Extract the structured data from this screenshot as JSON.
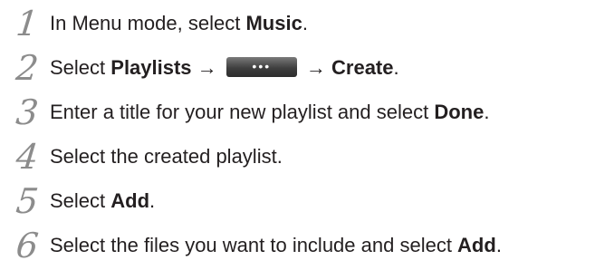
{
  "steps": [
    {
      "number": "1",
      "parts": [
        {
          "text": "In Menu mode, select ",
          "bold": false
        },
        {
          "text": "Music",
          "bold": true
        },
        {
          "text": ".",
          "bold": false
        }
      ]
    },
    {
      "number": "2",
      "parts": [
        {
          "text": "Select ",
          "bold": false
        },
        {
          "text": "Playlists",
          "bold": true
        },
        {
          "text": " → ",
          "bold": false
        },
        {
          "button": "•••"
        },
        {
          "text": " → ",
          "bold": false
        },
        {
          "text": "Create",
          "bold": true
        },
        {
          "text": ".",
          "bold": false
        }
      ]
    },
    {
      "number": "3",
      "parts": [
        {
          "text": "Enter a title for your new playlist and select ",
          "bold": false
        },
        {
          "text": "Done",
          "bold": true
        },
        {
          "text": ".",
          "bold": false
        }
      ]
    },
    {
      "number": "4",
      "parts": [
        {
          "text": "Select the created playlist.",
          "bold": false
        }
      ]
    },
    {
      "number": "5",
      "parts": [
        {
          "text": "Select ",
          "bold": false
        },
        {
          "text": "Add",
          "bold": true
        },
        {
          "text": ".",
          "bold": false
        }
      ]
    },
    {
      "number": "6",
      "parts": [
        {
          "text": "Select the files you want to include and select ",
          "bold": false
        },
        {
          "text": "Add",
          "bold": true
        },
        {
          "text": ".",
          "bold": false
        }
      ]
    }
  ],
  "icons": {
    "more_button": "more-options-icon"
  }
}
